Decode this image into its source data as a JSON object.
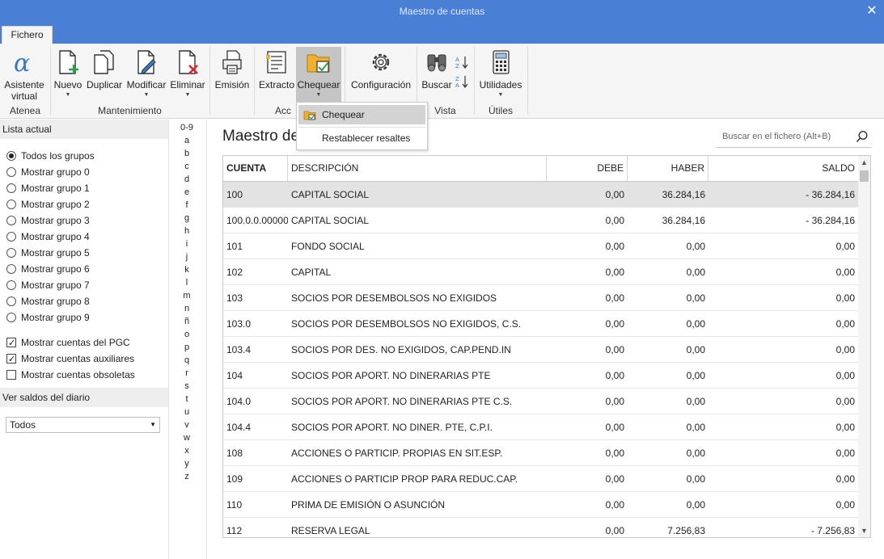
{
  "window": {
    "title": "Maestro de cuentas",
    "close_icon": "✕"
  },
  "tabs": {
    "fichero": "Fichero"
  },
  "ribbon": {
    "asistente": "Asistente virtual",
    "nuevo": "Nuevo",
    "duplicar": "Duplicar",
    "modificar": "Modificar",
    "eliminar": "Eliminar",
    "emision": "Emisión",
    "extracto": "Extracto",
    "chequear": "Chequear",
    "configuracion": "Configuración",
    "buscar": "Buscar",
    "utilidades": "Utilidades",
    "groups": {
      "atenea": "Atenea",
      "mantenimiento": "Mantenimiento",
      "acciones": "Acc",
      "vista": "Vista",
      "utiles": "Útiles"
    }
  },
  "dropdown": {
    "chequear": "Chequear",
    "restablecer": "Restablecer resaltes"
  },
  "left": {
    "lista_actual": "Lista actual",
    "radios": [
      "Todos los grupos",
      "Mostrar grupo 0",
      "Mostrar grupo 1",
      "Mostrar grupo 2",
      "Mostrar grupo 3",
      "Mostrar grupo 4",
      "Mostrar grupo 5",
      "Mostrar grupo 6",
      "Mostrar grupo 7",
      "Mostrar grupo 8",
      "Mostrar grupo 9"
    ],
    "selected_radio": "Todos los grupos",
    "checks": [
      {
        "label": "Mostrar cuentas del PGC",
        "checked": true
      },
      {
        "label": "Mostrar cuentas auxiliares",
        "checked": true
      },
      {
        "label": "Mostrar cuentas obsoletas",
        "checked": false
      }
    ],
    "ver_saldos": "Ver saldos del diario",
    "saldos_value": "Todos"
  },
  "alphabet": [
    "0-9",
    "a",
    "b",
    "c",
    "d",
    "e",
    "f",
    "g",
    "h",
    "i",
    "j",
    "k",
    "l",
    "m",
    "n",
    "ñ",
    "o",
    "p",
    "q",
    "r",
    "s",
    "t",
    "u",
    "v",
    "w",
    "x",
    "y",
    "z"
  ],
  "main": {
    "title": "Maestro de cuentas",
    "search_placeholder": "Buscar en el fichero (Alt+B)"
  },
  "table": {
    "headers": {
      "cuenta": "CUENTA",
      "descripcion": "DESCRIPCIÓN",
      "debe": "DEBE",
      "haber": "HABER",
      "saldo": "SALDO"
    },
    "rows": [
      {
        "cuenta": "100",
        "descripcion": "CAPITAL SOCIAL",
        "debe": "0,00",
        "haber": "36.284,16",
        "saldo": "- 36.284,16"
      },
      {
        "cuenta": "100.0.0.00000",
        "descripcion": "CAPITAL SOCIAL",
        "debe": "0,00",
        "haber": "36.284,16",
        "saldo": "- 36.284,16"
      },
      {
        "cuenta": "101",
        "descripcion": "FONDO SOCIAL",
        "debe": "0,00",
        "haber": "0,00",
        "saldo": "0,00"
      },
      {
        "cuenta": "102",
        "descripcion": "CAPITAL",
        "debe": "0,00",
        "haber": "0,00",
        "saldo": "0,00"
      },
      {
        "cuenta": "103",
        "descripcion": "SOCIOS POR DESEMBOLSOS NO EXIGIDOS",
        "debe": "0,00",
        "haber": "0,00",
        "saldo": "0,00"
      },
      {
        "cuenta": "103.0",
        "descripcion": "SOCIOS POR DESEMBOLSOS NO EXIGIDOS, C.S.",
        "debe": "0,00",
        "haber": "0,00",
        "saldo": "0,00"
      },
      {
        "cuenta": "103.4",
        "descripcion": "SOCIOS POR DES. NO EXIGIDOS, CAP.PEND.IN",
        "debe": "0,00",
        "haber": "0,00",
        "saldo": "0,00"
      },
      {
        "cuenta": "104",
        "descripcion": "SOCIOS POR APORT. NO DINERARIAS PTE",
        "debe": "0,00",
        "haber": "0,00",
        "saldo": "0,00"
      },
      {
        "cuenta": "104.0",
        "descripcion": "SOCIOS POR APORT. NO DINERARIAS PTE C.S.",
        "debe": "0,00",
        "haber": "0,00",
        "saldo": "0,00"
      },
      {
        "cuenta": "104.4",
        "descripcion": "SOCIOS POR APORT. NO DINER. PTE, C.P.I.",
        "debe": "0,00",
        "haber": "0,00",
        "saldo": "0,00"
      },
      {
        "cuenta": "108",
        "descripcion": "ACCIONES O PARTICIP. PROPIAS EN SIT.ESP.",
        "debe": "0,00",
        "haber": "0,00",
        "saldo": "0,00"
      },
      {
        "cuenta": "109",
        "descripcion": "ACCIONES O PARTICIP PROP PARA REDUC.CAP.",
        "debe": "0,00",
        "haber": "0,00",
        "saldo": "0,00"
      },
      {
        "cuenta": "110",
        "descripcion": "PRIMA DE EMISIÓN O ASUNCIÓN",
        "debe": "0,00",
        "haber": "0,00",
        "saldo": "0,00"
      },
      {
        "cuenta": "112",
        "descripcion": "RESERVA LEGAL",
        "debe": "0,00",
        "haber": "7.256,83",
        "saldo": "- 7.256,83"
      }
    ],
    "selected_row": 0
  },
  "colors": {
    "titlebar": "#4a7fd6",
    "ribbon": "#f5f5f5",
    "selected_row": "#e3e3e3",
    "accent_green": "#2ca24c",
    "accent_red": "#d9262c",
    "folder": "#f0b030"
  }
}
